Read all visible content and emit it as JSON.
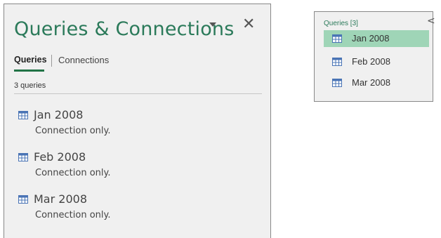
{
  "queries_pane": {
    "title": "Queries & Connections",
    "menu_icon": "dropdown-triangle-icon",
    "close_icon": "close-icon",
    "close_glyph": "✕",
    "tabs": [
      {
        "label": "Queries",
        "active": true
      },
      {
        "label": "Connections",
        "active": false
      }
    ],
    "count_label": "3 queries",
    "items": [
      {
        "name": "Jan 2008",
        "status": "Connection only.",
        "icon": "table-icon"
      },
      {
        "name": "Feb 2008",
        "status": "Connection only.",
        "icon": "table-icon"
      },
      {
        "name": "Mar 2008",
        "status": "Connection only.",
        "icon": "table-icon"
      }
    ]
  },
  "navigator_pane": {
    "header": "Queries [3]",
    "collapse_glyph": "<",
    "items": [
      {
        "name": "Jan 2008",
        "selected": true,
        "icon": "table-icon"
      },
      {
        "name": "Feb 2008",
        "selected": false,
        "icon": "table-icon"
      },
      {
        "name": "Mar 2008",
        "selected": false,
        "icon": "table-icon"
      }
    ]
  },
  "colors": {
    "accent_green": "#217346",
    "title_green": "#2b7a5a",
    "selection": "#9fd5b7",
    "icon_blue": "#4a74b5"
  }
}
